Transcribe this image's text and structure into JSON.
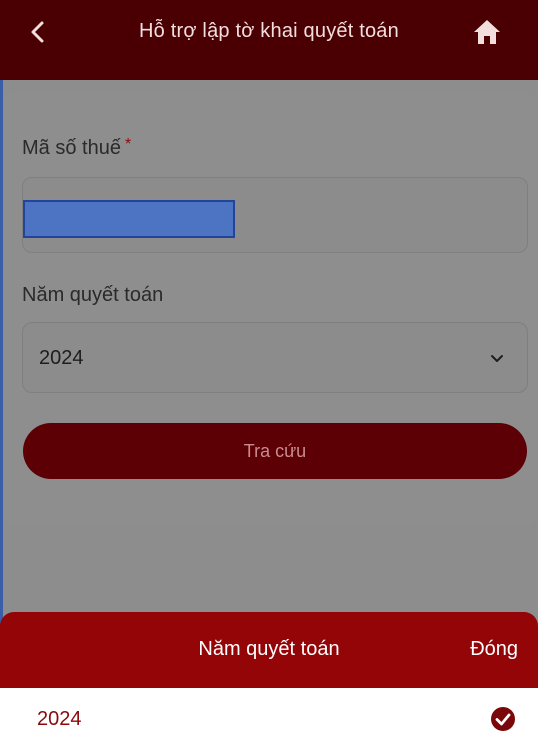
{
  "header": {
    "title": "Hỗ trợ lập tờ khai quyết toán",
    "back_icon": "chevron-left-icon",
    "home_icon": "home-icon"
  },
  "form": {
    "tax_code_label": "Mã số thuế",
    "required_mark": "*",
    "tax_code_value": "",
    "year_label": "Năm quyết toán",
    "year_value": "2024",
    "search_button": "Tra cứu"
  },
  "sheet": {
    "title": "Năm quyết toán",
    "close_label": "Đóng",
    "options": [
      {
        "label": "2024",
        "selected": true
      }
    ]
  },
  "colors": {
    "header_bg": "#4a0003",
    "sheet_header_bg": "#930507",
    "accent": "#8a0a0d",
    "highlight": "#4c74c2"
  }
}
